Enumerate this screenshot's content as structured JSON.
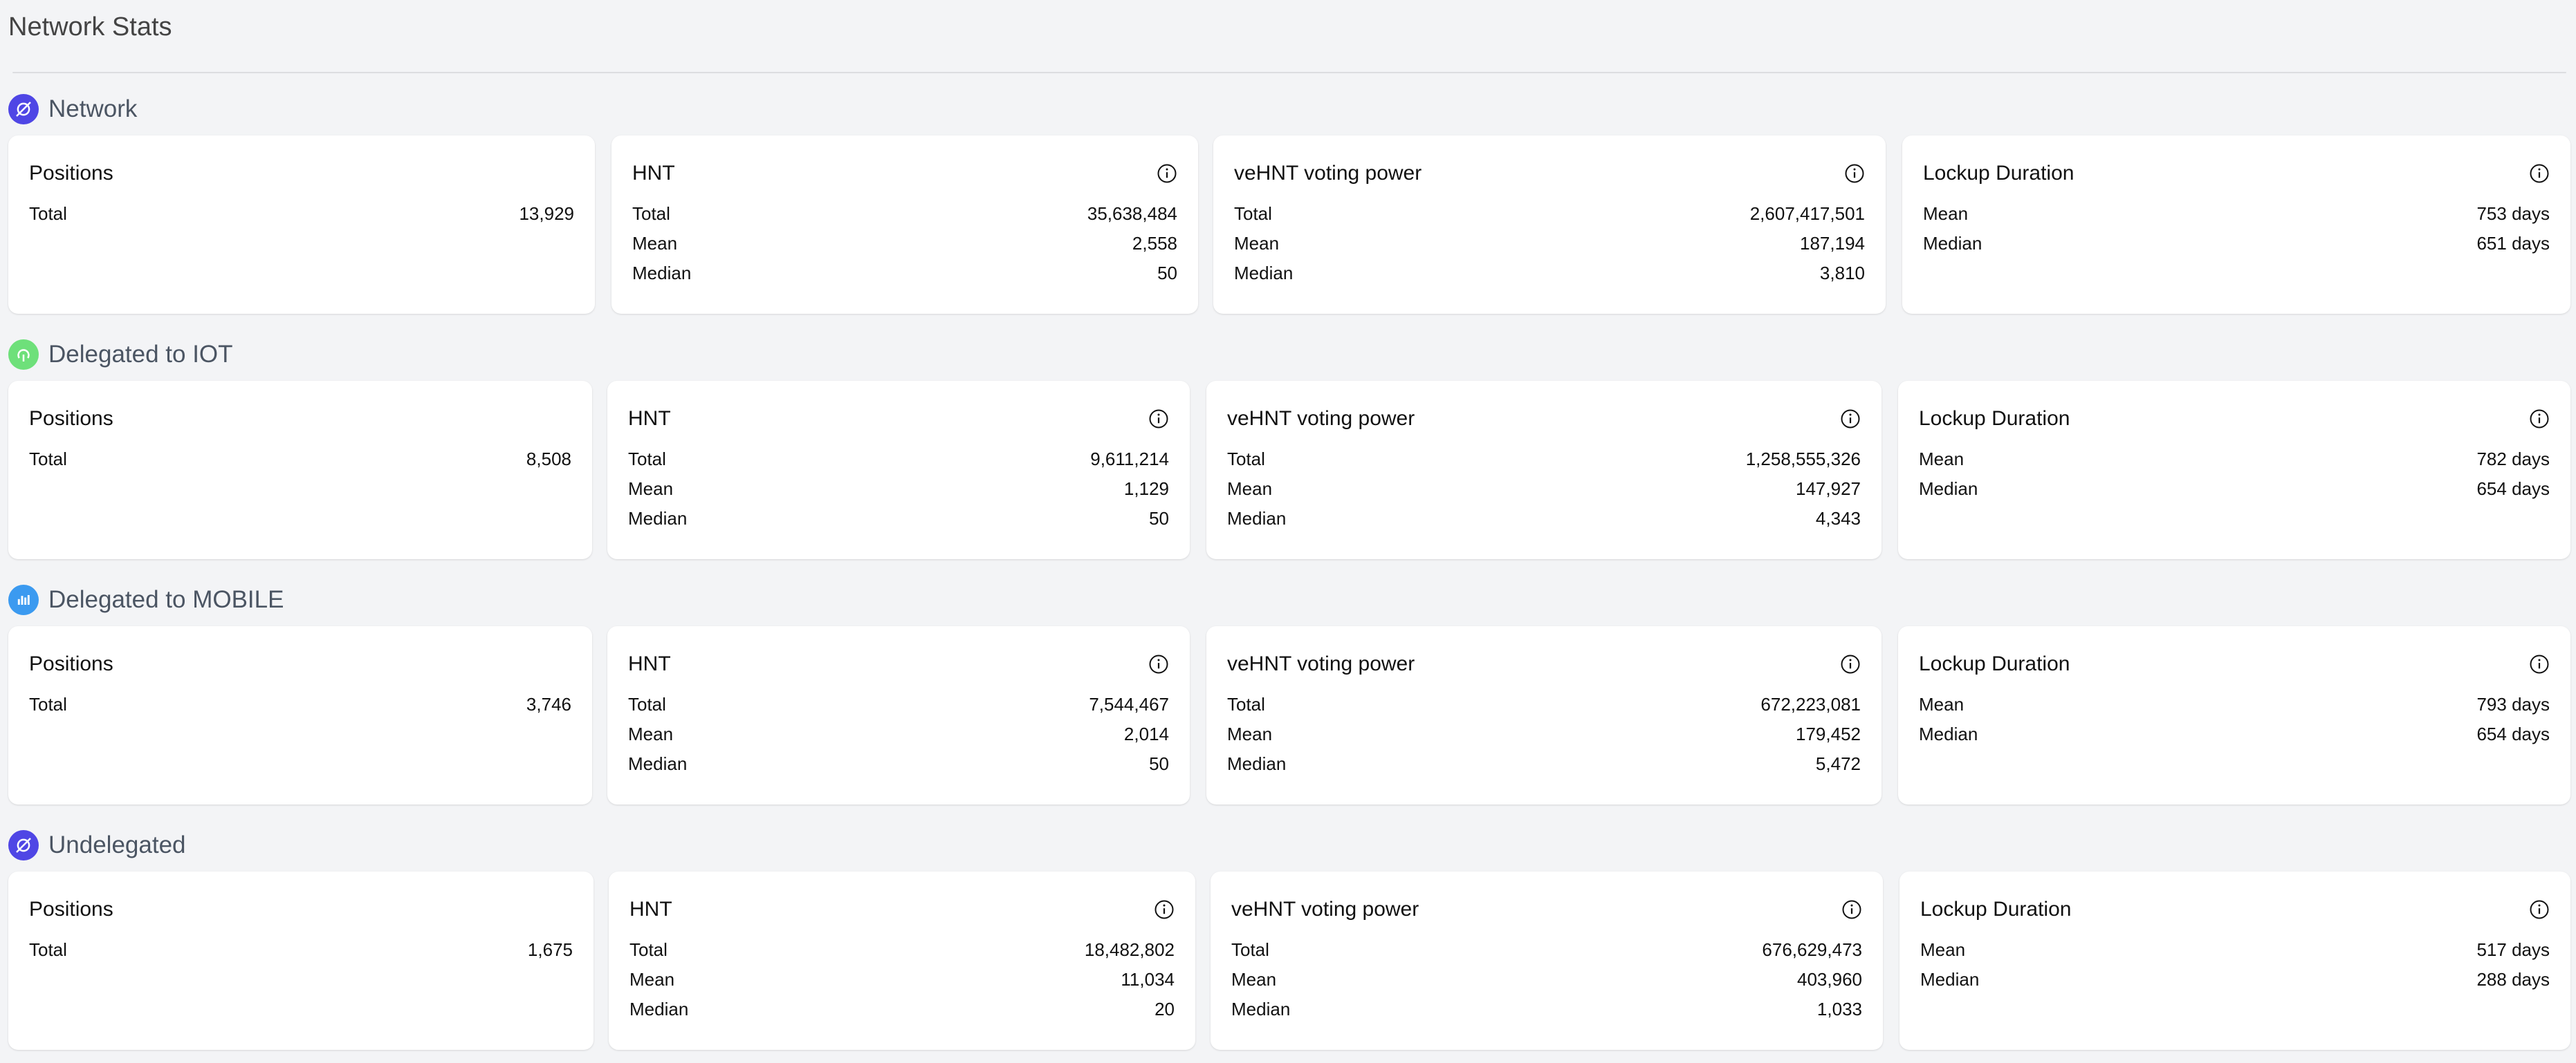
{
  "page": {
    "title": "Network Stats"
  },
  "labels": {
    "positions": "Positions",
    "hnt": "HNT",
    "vehnt": "veHNT voting power",
    "lockup": "Lockup Duration",
    "total": "Total",
    "mean": "Mean",
    "median": "Median"
  },
  "sections": [
    {
      "title": "Network",
      "icon": "network-icon",
      "icon_color": "#4f46e5",
      "positions": {
        "total": "13,929"
      },
      "hnt": {
        "total": "35,638,484",
        "mean": "2,558",
        "median": "50"
      },
      "vehnt": {
        "total": "2,607,417,501",
        "mean": "187,194",
        "median": "3,810"
      },
      "lockup": {
        "mean": "753 days",
        "median": "651 days"
      }
    },
    {
      "title": "Delegated to IOT",
      "icon": "iot-icon",
      "icon_color": "#6ee07a",
      "positions": {
        "total": "8,508"
      },
      "hnt": {
        "total": "9,611,214",
        "mean": "1,129",
        "median": "50"
      },
      "vehnt": {
        "total": "1,258,555,326",
        "mean": "147,927",
        "median": "4,343"
      },
      "lockup": {
        "mean": "782 days",
        "median": "654 days"
      }
    },
    {
      "title": "Delegated to MOBILE",
      "icon": "mobile-icon",
      "icon_color": "#3b9af0",
      "positions": {
        "total": "3,746"
      },
      "hnt": {
        "total": "7,544,467",
        "mean": "2,014",
        "median": "50"
      },
      "vehnt": {
        "total": "672,223,081",
        "mean": "179,452",
        "median": "5,472"
      },
      "lockup": {
        "mean": "793 days",
        "median": "654 days"
      }
    },
    {
      "title": "Undelegated",
      "icon": "undelegated-icon",
      "icon_color": "#4f46e5",
      "positions": {
        "total": "1,675"
      },
      "hnt": {
        "total": "18,482,802",
        "mean": "11,034",
        "median": "20"
      },
      "vehnt": {
        "total": "676,629,473",
        "mean": "403,960",
        "median": "1,033"
      },
      "lockup": {
        "mean": "517 days",
        "median": "288 days"
      }
    }
  ]
}
